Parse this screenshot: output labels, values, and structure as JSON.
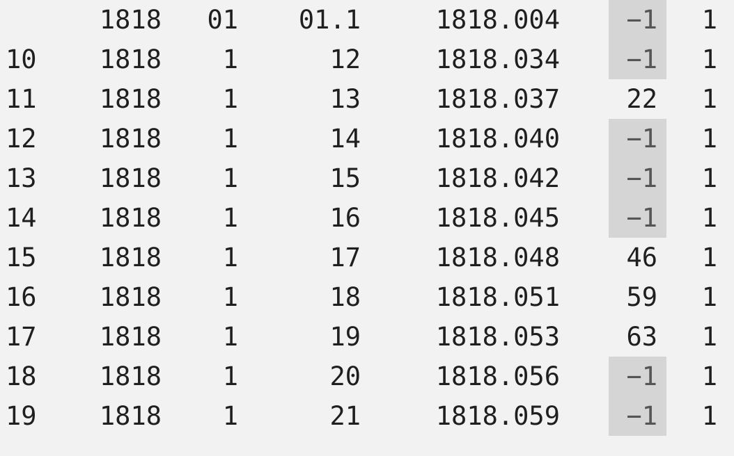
{
  "colors": {
    "background": "#f2f2f2",
    "text": "#1f1f1f",
    "missing_highlight": "#d5d5d5",
    "missing_text": "#555555"
  },
  "rows": [
    {
      "index": "",
      "year": "1818",
      "month": "01",
      "day": "01.1",
      "decimal_date": "1818.004",
      "value": "−1",
      "flag": "1",
      "missing": true
    },
    {
      "index": "10",
      "year": "1818",
      "month": "1",
      "day": "12",
      "decimal_date": "1818.034",
      "value": "−1",
      "flag": "1",
      "missing": true
    },
    {
      "index": "11",
      "year": "1818",
      "month": "1",
      "day": "13",
      "decimal_date": "1818.037",
      "value": "22",
      "flag": "1",
      "missing": false
    },
    {
      "index": "12",
      "year": "1818",
      "month": "1",
      "day": "14",
      "decimal_date": "1818.040",
      "value": "−1",
      "flag": "1",
      "missing": true
    },
    {
      "index": "13",
      "year": "1818",
      "month": "1",
      "day": "15",
      "decimal_date": "1818.042",
      "value": "−1",
      "flag": "1",
      "missing": true
    },
    {
      "index": "14",
      "year": "1818",
      "month": "1",
      "day": "16",
      "decimal_date": "1818.045",
      "value": "−1",
      "flag": "1",
      "missing": true
    },
    {
      "index": "15",
      "year": "1818",
      "month": "1",
      "day": "17",
      "decimal_date": "1818.048",
      "value": "46",
      "flag": "1",
      "missing": false
    },
    {
      "index": "16",
      "year": "1818",
      "month": "1",
      "day": "18",
      "decimal_date": "1818.051",
      "value": "59",
      "flag": "1",
      "missing": false
    },
    {
      "index": "17",
      "year": "1818",
      "month": "1",
      "day": "19",
      "decimal_date": "1818.053",
      "value": "63",
      "flag": "1",
      "missing": false
    },
    {
      "index": "18",
      "year": "1818",
      "month": "1",
      "day": "20",
      "decimal_date": "1818.056",
      "value": "−1",
      "flag": "1",
      "missing": true
    },
    {
      "index": "19",
      "year": "1818",
      "month": "1",
      "day": "21",
      "decimal_date": "1818.059",
      "value": "−1",
      "flag": "1",
      "missing": true
    }
  ]
}
